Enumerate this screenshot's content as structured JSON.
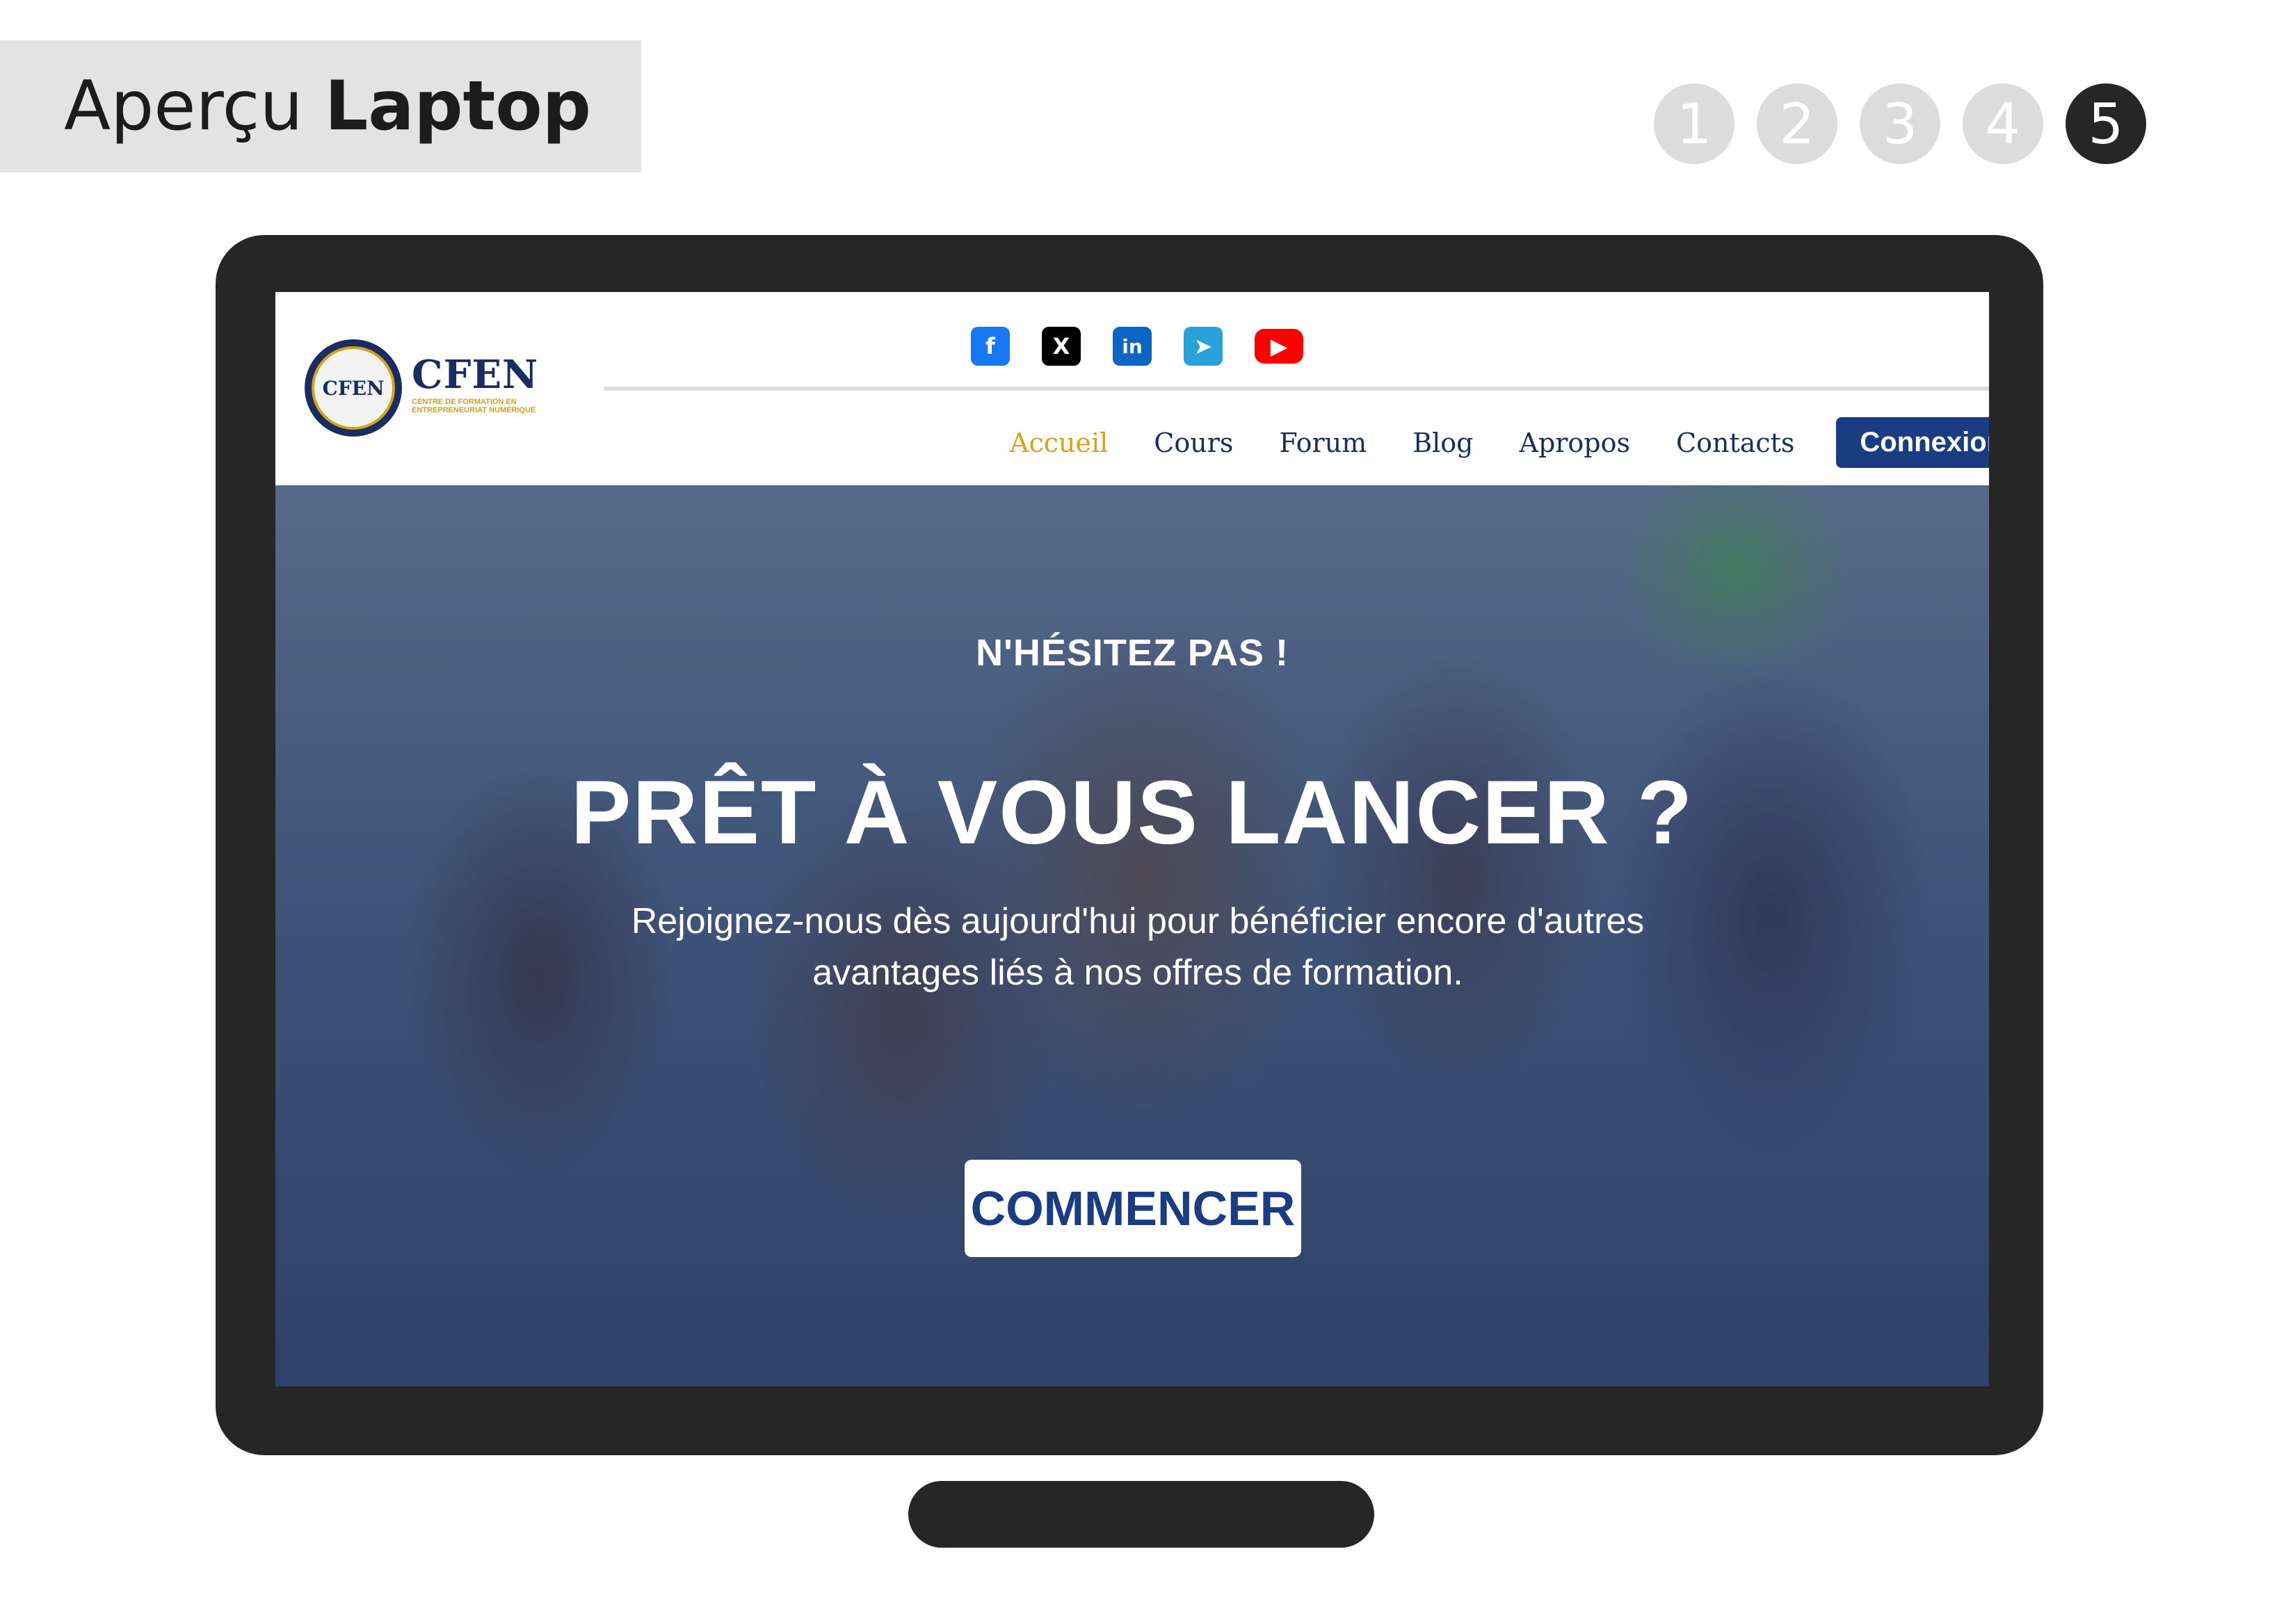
{
  "header": {
    "title_regular": "Aperçu",
    "title_bold": "Laptop"
  },
  "steps": [
    "1",
    "2",
    "3",
    "4",
    "5"
  ],
  "active_step": "5",
  "site": {
    "logo": {
      "emblem_text": "CFEN",
      "name": "CFEN",
      "tagline": "CENTRE DE FORMATION EN ENTREPRENEURIAT NUMÉRIQUE"
    },
    "socials": [
      {
        "icon": "facebook-icon",
        "glyph": "f"
      },
      {
        "icon": "x-twitter-icon",
        "glyph": "X"
      },
      {
        "icon": "linkedin-icon",
        "glyph": "in"
      },
      {
        "icon": "telegram-icon",
        "glyph": "➤"
      },
      {
        "icon": "youtube-icon",
        "glyph": "▶"
      }
    ],
    "nav": {
      "items": [
        "Accueil",
        "Cours",
        "Forum",
        "Blog",
        "Apropos",
        "Contacts"
      ],
      "active": "Accueil",
      "login_label": "Connexion"
    },
    "hero": {
      "kicker": "N'HÉSITEZ PAS !",
      "headline": "PRÊT À VOUS LANCER ?",
      "subtext_line1": "Rejoignez-nous dès aujourd'hui pour bénéficier encore d'autres",
      "subtext_line2": "avantages liés à nos offres de formation.",
      "cta_label": "COMMENCER"
    }
  },
  "colors": {
    "navy": "#1a2d63",
    "gold": "#d8a11a",
    "button_blue": "#1a3c82",
    "frame": "#262626"
  }
}
